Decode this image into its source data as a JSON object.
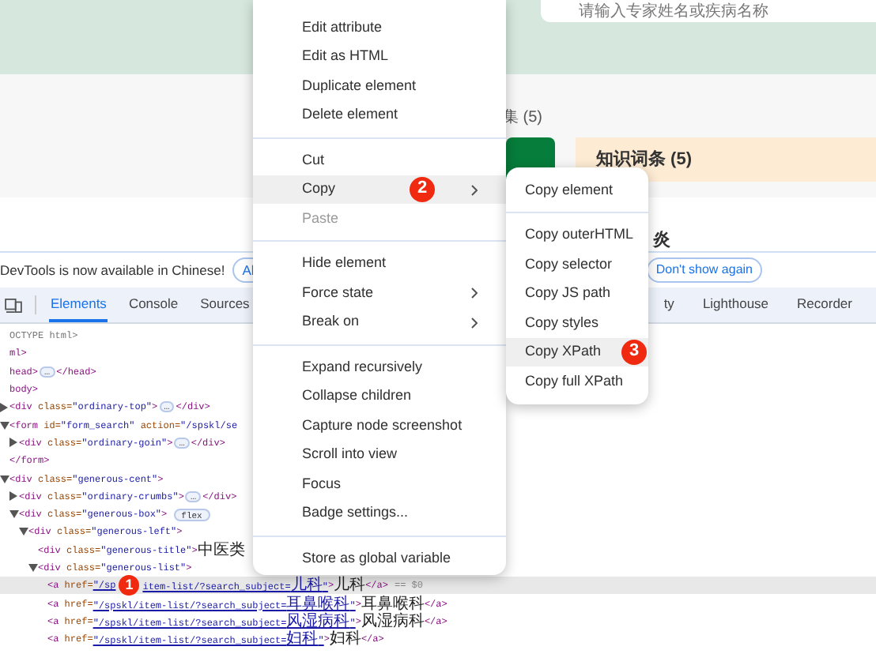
{
  "page": {
    "search": {
      "placeholder": "请输入专家姓名或疾病名称"
    },
    "section_heading": "集 (5)",
    "card_title": "知识词条 (5)",
    "subheading": "炎"
  },
  "devtools": {
    "notice": {
      "message": "DevTools is now available in Chinese!",
      "buttons": [
        {
          "label": "Al",
          "kind": "outline"
        },
        {
          "label": "Don't show again",
          "kind": "link"
        }
      ]
    },
    "tabs": [
      {
        "label": "Elements",
        "selected": true
      },
      {
        "label": "Console",
        "selected": false
      },
      {
        "label": "Sources",
        "selected": false
      },
      {
        "label": "ty",
        "selected": false
      },
      {
        "label": "Lighthouse",
        "selected": false
      },
      {
        "label": "Recorder",
        "selected": false
      }
    ],
    "tree": [
      {
        "tokens": [
          {
            "kind": "doctype",
            "text": "OCTYPE html>"
          }
        ]
      },
      {
        "tokens": [
          {
            "kind": "tag",
            "text": "ml>"
          }
        ]
      },
      {
        "tokens": [
          {
            "kind": "tag",
            "text": "head>"
          },
          {
            "kind": "ellipsis",
            "text": "…"
          },
          {
            "kind": "tag",
            "text": "</head>"
          }
        ]
      },
      {
        "tokens": [
          {
            "kind": "tag",
            "text": "body>"
          }
        ]
      },
      {
        "expanded": false,
        "tokens": [
          {
            "kind": "tag",
            "text": "<div"
          },
          {
            "kind": "attr",
            "text": " class="
          },
          {
            "kind": "value",
            "text": "\"ordinary-top\""
          },
          {
            "kind": "tag",
            "text": ">"
          },
          {
            "kind": "ellipsis",
            "text": "…"
          },
          {
            "kind": "tag",
            "text": "</div>"
          }
        ]
      },
      {
        "expanded": true,
        "tokens": [
          {
            "kind": "tag",
            "text": "<form"
          },
          {
            "kind": "attr",
            "text": " id="
          },
          {
            "kind": "value",
            "text": "\"form_search\""
          },
          {
            "kind": "attr",
            "text": " action="
          },
          {
            "kind": "value",
            "text": "\"/spskl/se"
          }
        ],
        "children": [
          {
            "expanded": false,
            "tokens": [
              {
                "kind": "tag",
                "text": "<div"
              },
              {
                "kind": "attr",
                "text": " class="
              },
              {
                "kind": "value",
                "text": "\"ordinary-goin\""
              },
              {
                "kind": "tag",
                "text": ">"
              },
              {
                "kind": "ellipsis",
                "text": "…"
              },
              {
                "kind": "tag",
                "text": "</div>"
              }
            ]
          }
        ]
      },
      {
        "tokens": [
          {
            "kind": "tag",
            "text": "</form>"
          }
        ]
      },
      {
        "expanded": true,
        "tokens": [
          {
            "kind": "tag",
            "text": "<div"
          },
          {
            "kind": "attr",
            "text": " class="
          },
          {
            "kind": "value",
            "text": "\"generous-cent\""
          },
          {
            "kind": "tag",
            "text": ">"
          }
        ],
        "children": [
          {
            "expanded": false,
            "tokens": [
              {
                "kind": "tag",
                "text": "<div"
              },
              {
                "kind": "attr",
                "text": " class="
              },
              {
                "kind": "value",
                "text": "\"ordinary-crumbs\""
              },
              {
                "kind": "tag",
                "text": ">"
              },
              {
                "kind": "ellipsis",
                "text": "…"
              },
              {
                "kind": "tag",
                "text": "</div>"
              }
            ]
          },
          {
            "expanded": true,
            "tokens": [
              {
                "kind": "tag",
                "text": "<div"
              },
              {
                "kind": "attr",
                "text": " class="
              },
              {
                "kind": "value",
                "text": "\"generous-box\""
              },
              {
                "kind": "tag",
                "text": ">"
              },
              {
                "kind": "badge",
                "text": "flex"
              }
            ],
            "children": [
              {
                "expanded": true,
                "tokens": [
                  {
                    "kind": "tag",
                    "text": "<div"
                  },
                  {
                    "kind": "attr",
                    "text": " class="
                  },
                  {
                    "kind": "value",
                    "text": "\"generous-left\""
                  },
                  {
                    "kind": "tag",
                    "text": ">"
                  }
                ],
                "children": [
                  {
                    "tokens": [
                      {
                        "kind": "tag",
                        "text": "<div"
                      },
                      {
                        "kind": "attr",
                        "text": " class="
                      },
                      {
                        "kind": "value",
                        "text": "\"generous-title\""
                      },
                      {
                        "kind": "tag",
                        "text": ">"
                      },
                      {
                        "kind": "text",
                        "text": "中医类"
                      }
                    ]
                  },
                  {
                    "expanded": true,
                    "tokens": [
                      {
                        "kind": "tag",
                        "text": "<div"
                      },
                      {
                        "kind": "attr",
                        "text": " class="
                      },
                      {
                        "kind": "value",
                        "text": "\"generous-list\""
                      },
                      {
                        "kind": "tag",
                        "text": ">"
                      }
                    ],
                    "children": [
                      {
                        "selected": true,
                        "tokens": [
                          {
                            "kind": "tag",
                            "text": "<a"
                          },
                          {
                            "kind": "attr",
                            "text": " href="
                          },
                          {
                            "kind": "link",
                            "text": "\"/sp"
                          },
                          {
                            "kind": "step_badge",
                            "text": "1"
                          },
                          {
                            "kind": "link",
                            "text": "item-list/?search_subject=儿科\""
                          },
                          {
                            "kind": "tag",
                            "text": ">"
                          },
                          {
                            "kind": "text",
                            "text": "儿科"
                          },
                          {
                            "kind": "tag",
                            "text": "</a>"
                          },
                          {
                            "kind": "dollar",
                            "text": "== $0"
                          }
                        ]
                      },
                      {
                        "selected": false,
                        "tokens": [
                          {
                            "kind": "tag",
                            "text": "<a"
                          },
                          {
                            "kind": "attr",
                            "text": " href="
                          },
                          {
                            "kind": "link",
                            "text": "\"/spskl/item-list/?search_subject=耳鼻喉科\""
                          },
                          {
                            "kind": "tag",
                            "text": ">"
                          },
                          {
                            "kind": "text",
                            "text": "耳鼻喉科"
                          },
                          {
                            "kind": "tag",
                            "text": "</a>"
                          }
                        ]
                      },
                      {
                        "selected": false,
                        "tokens": [
                          {
                            "kind": "tag",
                            "text": "<a"
                          },
                          {
                            "kind": "attr",
                            "text": " href="
                          },
                          {
                            "kind": "link",
                            "text": "\"/spskl/item-list/?search_subject=风湿病科\""
                          },
                          {
                            "kind": "tag",
                            "text": ">"
                          },
                          {
                            "kind": "text",
                            "text": "风湿病科"
                          },
                          {
                            "kind": "tag",
                            "text": "</a>"
                          }
                        ]
                      },
                      {
                        "selected": false,
                        "tokens": [
                          {
                            "kind": "tag",
                            "text": "<a"
                          },
                          {
                            "kind": "attr",
                            "text": " href="
                          },
                          {
                            "kind": "link",
                            "text": "\"/spskl/item-list/?search_subject=妇科\""
                          },
                          {
                            "kind": "tag",
                            "text": ">"
                          },
                          {
                            "kind": "text",
                            "text": "妇科"
                          },
                          {
                            "kind": "tag",
                            "text": "</a>"
                          }
                        ]
                      }
                    ]
                  }
                ]
              }
            ]
          }
        ]
      }
    ]
  },
  "context_menu": [
    {
      "kind": "item",
      "label": "Edit attribute",
      "selected": false,
      "disabled": false,
      "has_submenu": false
    },
    {
      "kind": "item",
      "label": "Edit as HTML",
      "selected": false,
      "disabled": false,
      "has_submenu": false
    },
    {
      "kind": "item",
      "label": "Duplicate element",
      "selected": false,
      "disabled": false,
      "has_submenu": false
    },
    {
      "kind": "item",
      "label": "Delete element",
      "selected": false,
      "disabled": false,
      "has_submenu": false
    },
    {
      "kind": "separator"
    },
    {
      "kind": "item",
      "label": "Cut",
      "selected": false,
      "disabled": false,
      "has_submenu": false
    },
    {
      "kind": "item",
      "label": "Copy",
      "selected": true,
      "disabled": false,
      "has_submenu": true,
      "step_badge": "2"
    },
    {
      "kind": "item",
      "label": "Paste",
      "selected": false,
      "disabled": true,
      "has_submenu": false
    },
    {
      "kind": "separator"
    },
    {
      "kind": "item",
      "label": "Hide element",
      "selected": false,
      "disabled": false,
      "has_submenu": false
    },
    {
      "kind": "item",
      "label": "Force state",
      "selected": false,
      "disabled": false,
      "has_submenu": true
    },
    {
      "kind": "item",
      "label": "Break on",
      "selected": false,
      "disabled": false,
      "has_submenu": true
    },
    {
      "kind": "separator"
    },
    {
      "kind": "item",
      "label": "Expand recursively",
      "selected": false,
      "disabled": false,
      "has_submenu": false
    },
    {
      "kind": "item",
      "label": "Collapse children",
      "selected": false,
      "disabled": false,
      "has_submenu": false
    },
    {
      "kind": "item",
      "label": "Capture node screenshot",
      "selected": false,
      "disabled": false,
      "has_submenu": false
    },
    {
      "kind": "item",
      "label": "Scroll into view",
      "selected": false,
      "disabled": false,
      "has_submenu": false
    },
    {
      "kind": "item",
      "label": "Focus",
      "selected": false,
      "disabled": false,
      "has_submenu": false
    },
    {
      "kind": "item",
      "label": "Badge settings...",
      "selected": false,
      "disabled": false,
      "has_submenu": false
    },
    {
      "kind": "separator"
    },
    {
      "kind": "item",
      "label": "Store as global variable",
      "selected": false,
      "disabled": false,
      "has_submenu": false
    }
  ],
  "copy_submenu": [
    {
      "kind": "item",
      "label": "Copy element",
      "selected": false,
      "disabled": false,
      "has_submenu": false
    },
    {
      "kind": "separator"
    },
    {
      "kind": "item",
      "label": "Copy outerHTML",
      "selected": false,
      "disabled": false,
      "has_submenu": false
    },
    {
      "kind": "item",
      "label": "Copy selector",
      "selected": false,
      "disabled": false,
      "has_submenu": false
    },
    {
      "kind": "item",
      "label": "Copy JS path",
      "selected": false,
      "disabled": false,
      "has_submenu": false
    },
    {
      "kind": "item",
      "label": "Copy styles",
      "selected": false,
      "disabled": false,
      "has_submenu": false
    },
    {
      "kind": "item",
      "label": "Copy XPath",
      "selected": true,
      "disabled": false,
      "has_submenu": false,
      "step_badge": "3"
    },
    {
      "kind": "item",
      "label": "Copy full XPath",
      "selected": false,
      "disabled": false,
      "has_submenu": false
    }
  ]
}
